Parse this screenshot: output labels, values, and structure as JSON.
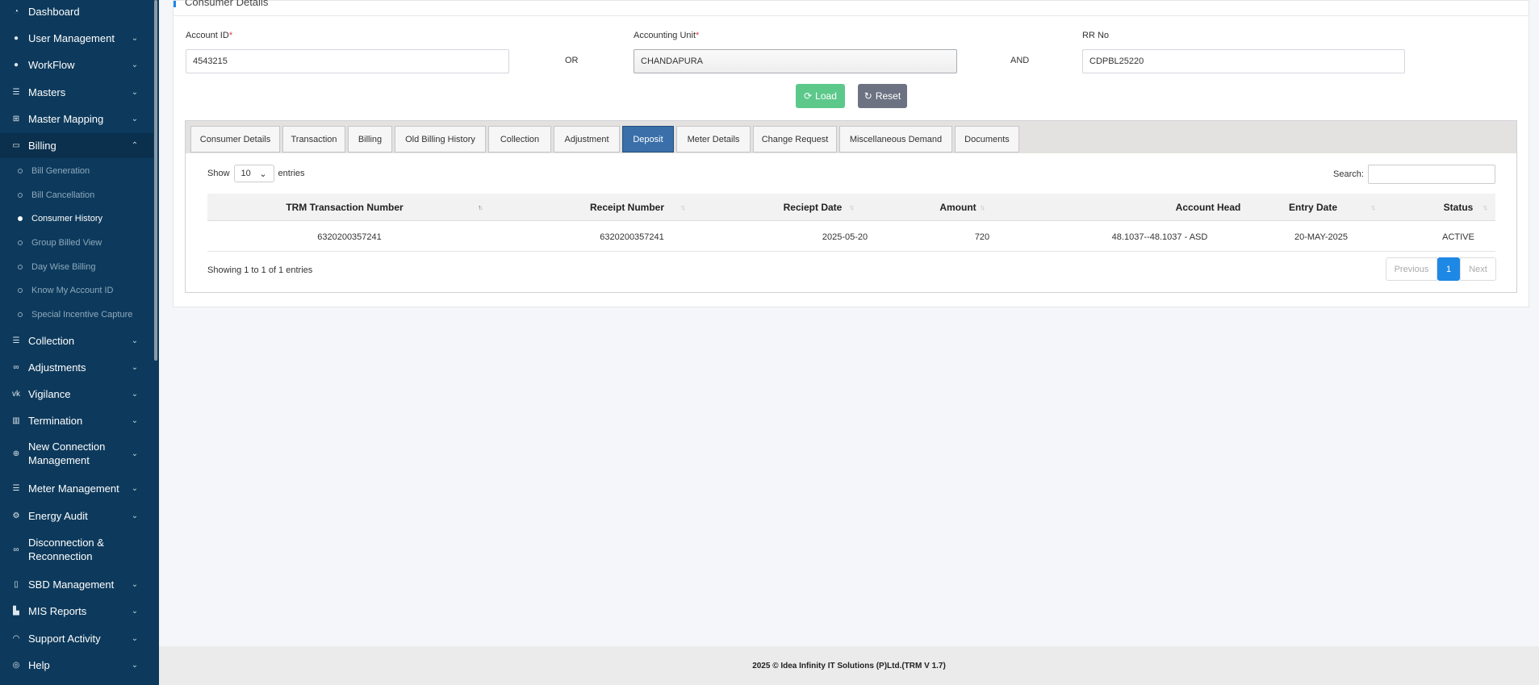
{
  "sidebar": {
    "items": [
      {
        "label": "Dashboard",
        "icon": "dashboard-icon"
      },
      {
        "label": "User Management",
        "icon": "user-icon"
      },
      {
        "label": "WorkFlow",
        "icon": "user-icon"
      },
      {
        "label": "Masters",
        "icon": "list-icon"
      },
      {
        "label": "Master Mapping",
        "icon": "sitemap-icon"
      },
      {
        "label": "Billing",
        "icon": "monitor-icon"
      },
      {
        "label": "Collection",
        "icon": "list-icon"
      },
      {
        "label": "Adjustments",
        "icon": "binoculars-icon"
      },
      {
        "label": "Vigilance",
        "icon": "vk-icon"
      },
      {
        "label": "Termination",
        "icon": "trash-icon"
      },
      {
        "label": "New Connection Management",
        "icon": "plus-circle-icon"
      },
      {
        "label": "Meter Management",
        "icon": "list-icon"
      },
      {
        "label": "Energy Audit",
        "icon": "cogs-icon"
      },
      {
        "label": "Disconnection & Reconnection",
        "icon": "link-icon"
      },
      {
        "label": "SBD Management",
        "icon": "mobile-icon"
      },
      {
        "label": "MIS Reports",
        "icon": "bar-chart-icon"
      },
      {
        "label": "Support Activity",
        "icon": "headset-icon"
      },
      {
        "label": "Help",
        "icon": "help-icon"
      }
    ],
    "billing_sub": [
      "Bill Generation",
      "Bill Cancellation",
      "Consumer History",
      "Group Billed View",
      "Day Wise Billing",
      "Know My Account ID",
      "Special Incentive Capture"
    ]
  },
  "form": {
    "title": "Consumer Details",
    "account_id_label": "Account ID",
    "account_id_value": "4543215",
    "or_label": "OR",
    "accounting_unit_label": "Accounting Unit",
    "accounting_unit_value": "CHANDAPURA",
    "and_label": "AND",
    "rr_no_label": "RR No",
    "rr_no_value": "CDPBL25220",
    "required_mark": "*",
    "load_label": "Load",
    "reset_label": "Reset"
  },
  "tabs": [
    "Consumer Details",
    "Transaction",
    "Billing",
    "Old Billing History",
    "Collection",
    "Adjustment",
    "Deposit",
    "Meter Details",
    "Change Request",
    "Miscellaneous Demand",
    "Documents"
  ],
  "active_tab": "Deposit",
  "table": {
    "show_label": "Show",
    "page_size": "10",
    "entries_label": "entries",
    "search_label": "Search:",
    "columns": [
      "TRM Transaction Number",
      "Receipt Number",
      "Reciept Date",
      "Amount",
      "Account Head",
      "Entry Date",
      "Status"
    ],
    "rows": [
      [
        "6320200357241",
        "6320200357241",
        "2025-05-20",
        "720",
        "48.1037--48.1037 - ASD",
        "20-MAY-2025",
        "ACTIVE"
      ]
    ],
    "info": "Showing 1 to 1 of 1 entries",
    "pager": {
      "previous": "Previous",
      "current": "1",
      "next": "Next"
    }
  },
  "footer": "2025 © Idea Infinity IT Solutions (P)Ltd.(TRM V 1.7)",
  "colors": {
    "sidebar_bg": "#0d3a5c",
    "active_tab": "#3a6fa9",
    "load_btn": "#5cc98b",
    "reset_btn": "#6c7282",
    "accent": "#1e88e5"
  }
}
